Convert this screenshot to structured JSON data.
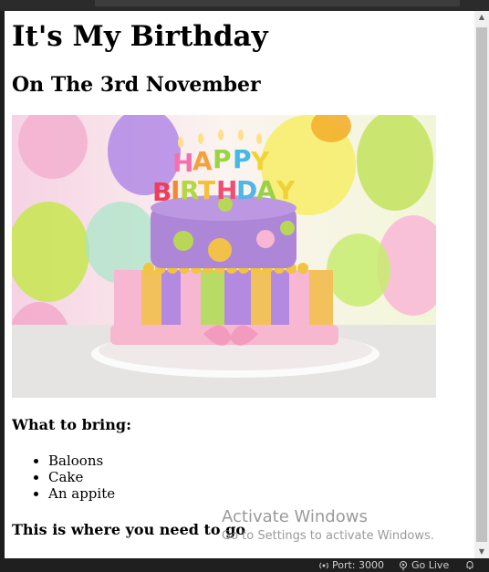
{
  "page": {
    "title": "It's My Birthday",
    "subtitle": "On The 3rd November",
    "image_alt": "Birthday cake",
    "cake_topper": "HAPPY BIRTHDAY",
    "bring_heading": "What to bring:",
    "items": [
      "Baloons",
      "Cake",
      "An appite"
    ],
    "where_heading": "This is where you need to go"
  },
  "watermark": {
    "line1": "Activate Windows",
    "line2": "Go to Settings to activate Windows."
  },
  "statusbar": {
    "port_label": "Port: 3000",
    "golive_label": "Go Live"
  },
  "icons": {
    "port": "broadcast-icon",
    "golive": "go-live-icon",
    "bell": "bell-icon"
  }
}
